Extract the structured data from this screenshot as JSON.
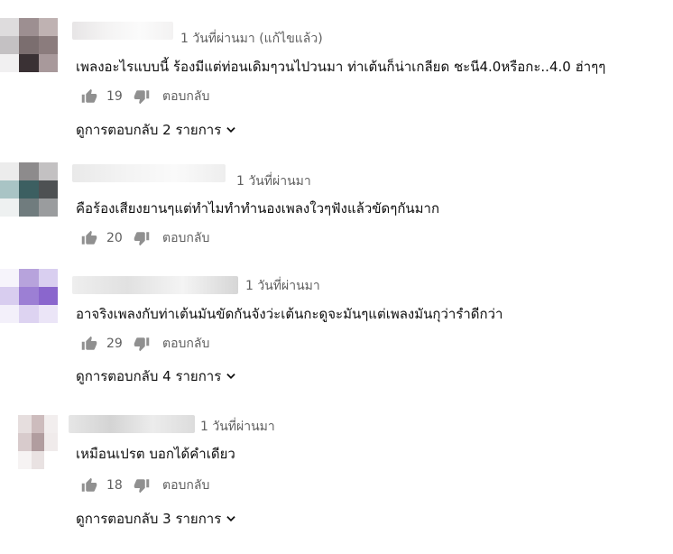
{
  "labels": {
    "reply": "ตอบกลับ"
  },
  "comments": [
    {
      "time": "1 วันที่ผ่านมา (แก้ไขแล้ว)",
      "text": "เพลงอะไรแบบนี้ ร้องมีแต่ท่อนเดิมๆวนไปวนมา ท่าเต้นก็น่าเกลียด ชะนี4.0หรือกะ..4.0  ฮ่าๆๆ",
      "likes": "19",
      "replies": "ดูการตอบกลับ 2 รายการ",
      "avatar_colors": [
        "#dedcdd",
        "#9d8f91",
        "#bfb2b2",
        "#c4c1c3",
        "#7b6e6f",
        "#8b7c7d",
        "#f1f0f1",
        "#3a3134",
        "#a8999b"
      ]
    },
    {
      "time": "1 วันที่ผ่านมา",
      "text": "คือร้องเสียงยานๆแต่ทำไมทำทำนองเพลงใวๆฟังแล้วขัดๆกันมาก",
      "likes": "20",
      "replies": "",
      "avatar_colors": [
        "#ececec",
        "#8d8b8c",
        "#c3c1c2",
        "#a9c4c5",
        "#3c5f61",
        "#4e5153",
        "#eef1f1",
        "#707c7e",
        "#9a9c9e"
      ]
    },
    {
      "time": "1 วันที่ผ่านมา",
      "text": "อาจริงเพลงกับท่าเต้นมันขัดกันจังว่ะเต้นกะดูจะมันๆแต่เพลงมันกุว่ารำดีกว่า",
      "likes": "29",
      "replies": "ดูการตอบกลับ 4 รายการ",
      "avatar_colors": [
        "#f6f4fb",
        "#b7a3dc",
        "#d9cff0",
        "#d8cdef",
        "#9c7fd4",
        "#8a66cd",
        "#f3f0fa",
        "#ddd3f1",
        "#ebe5f7"
      ]
    },
    {
      "time": "1 วันที่ผ่านมา",
      "text": "เหมือนเปรต บอกได้คำเดียว",
      "likes": "18",
      "replies": "ดูการตอบกลับ 3 รายการ",
      "avatar_colors": [
        "#e6dede",
        "#cdbcbd",
        "#f2eeee",
        "#d8cbcc",
        "#b19d9f",
        "#f0ebeb",
        "#f6f3f3",
        "#e9e2e2",
        "#ffffff"
      ]
    }
  ]
}
